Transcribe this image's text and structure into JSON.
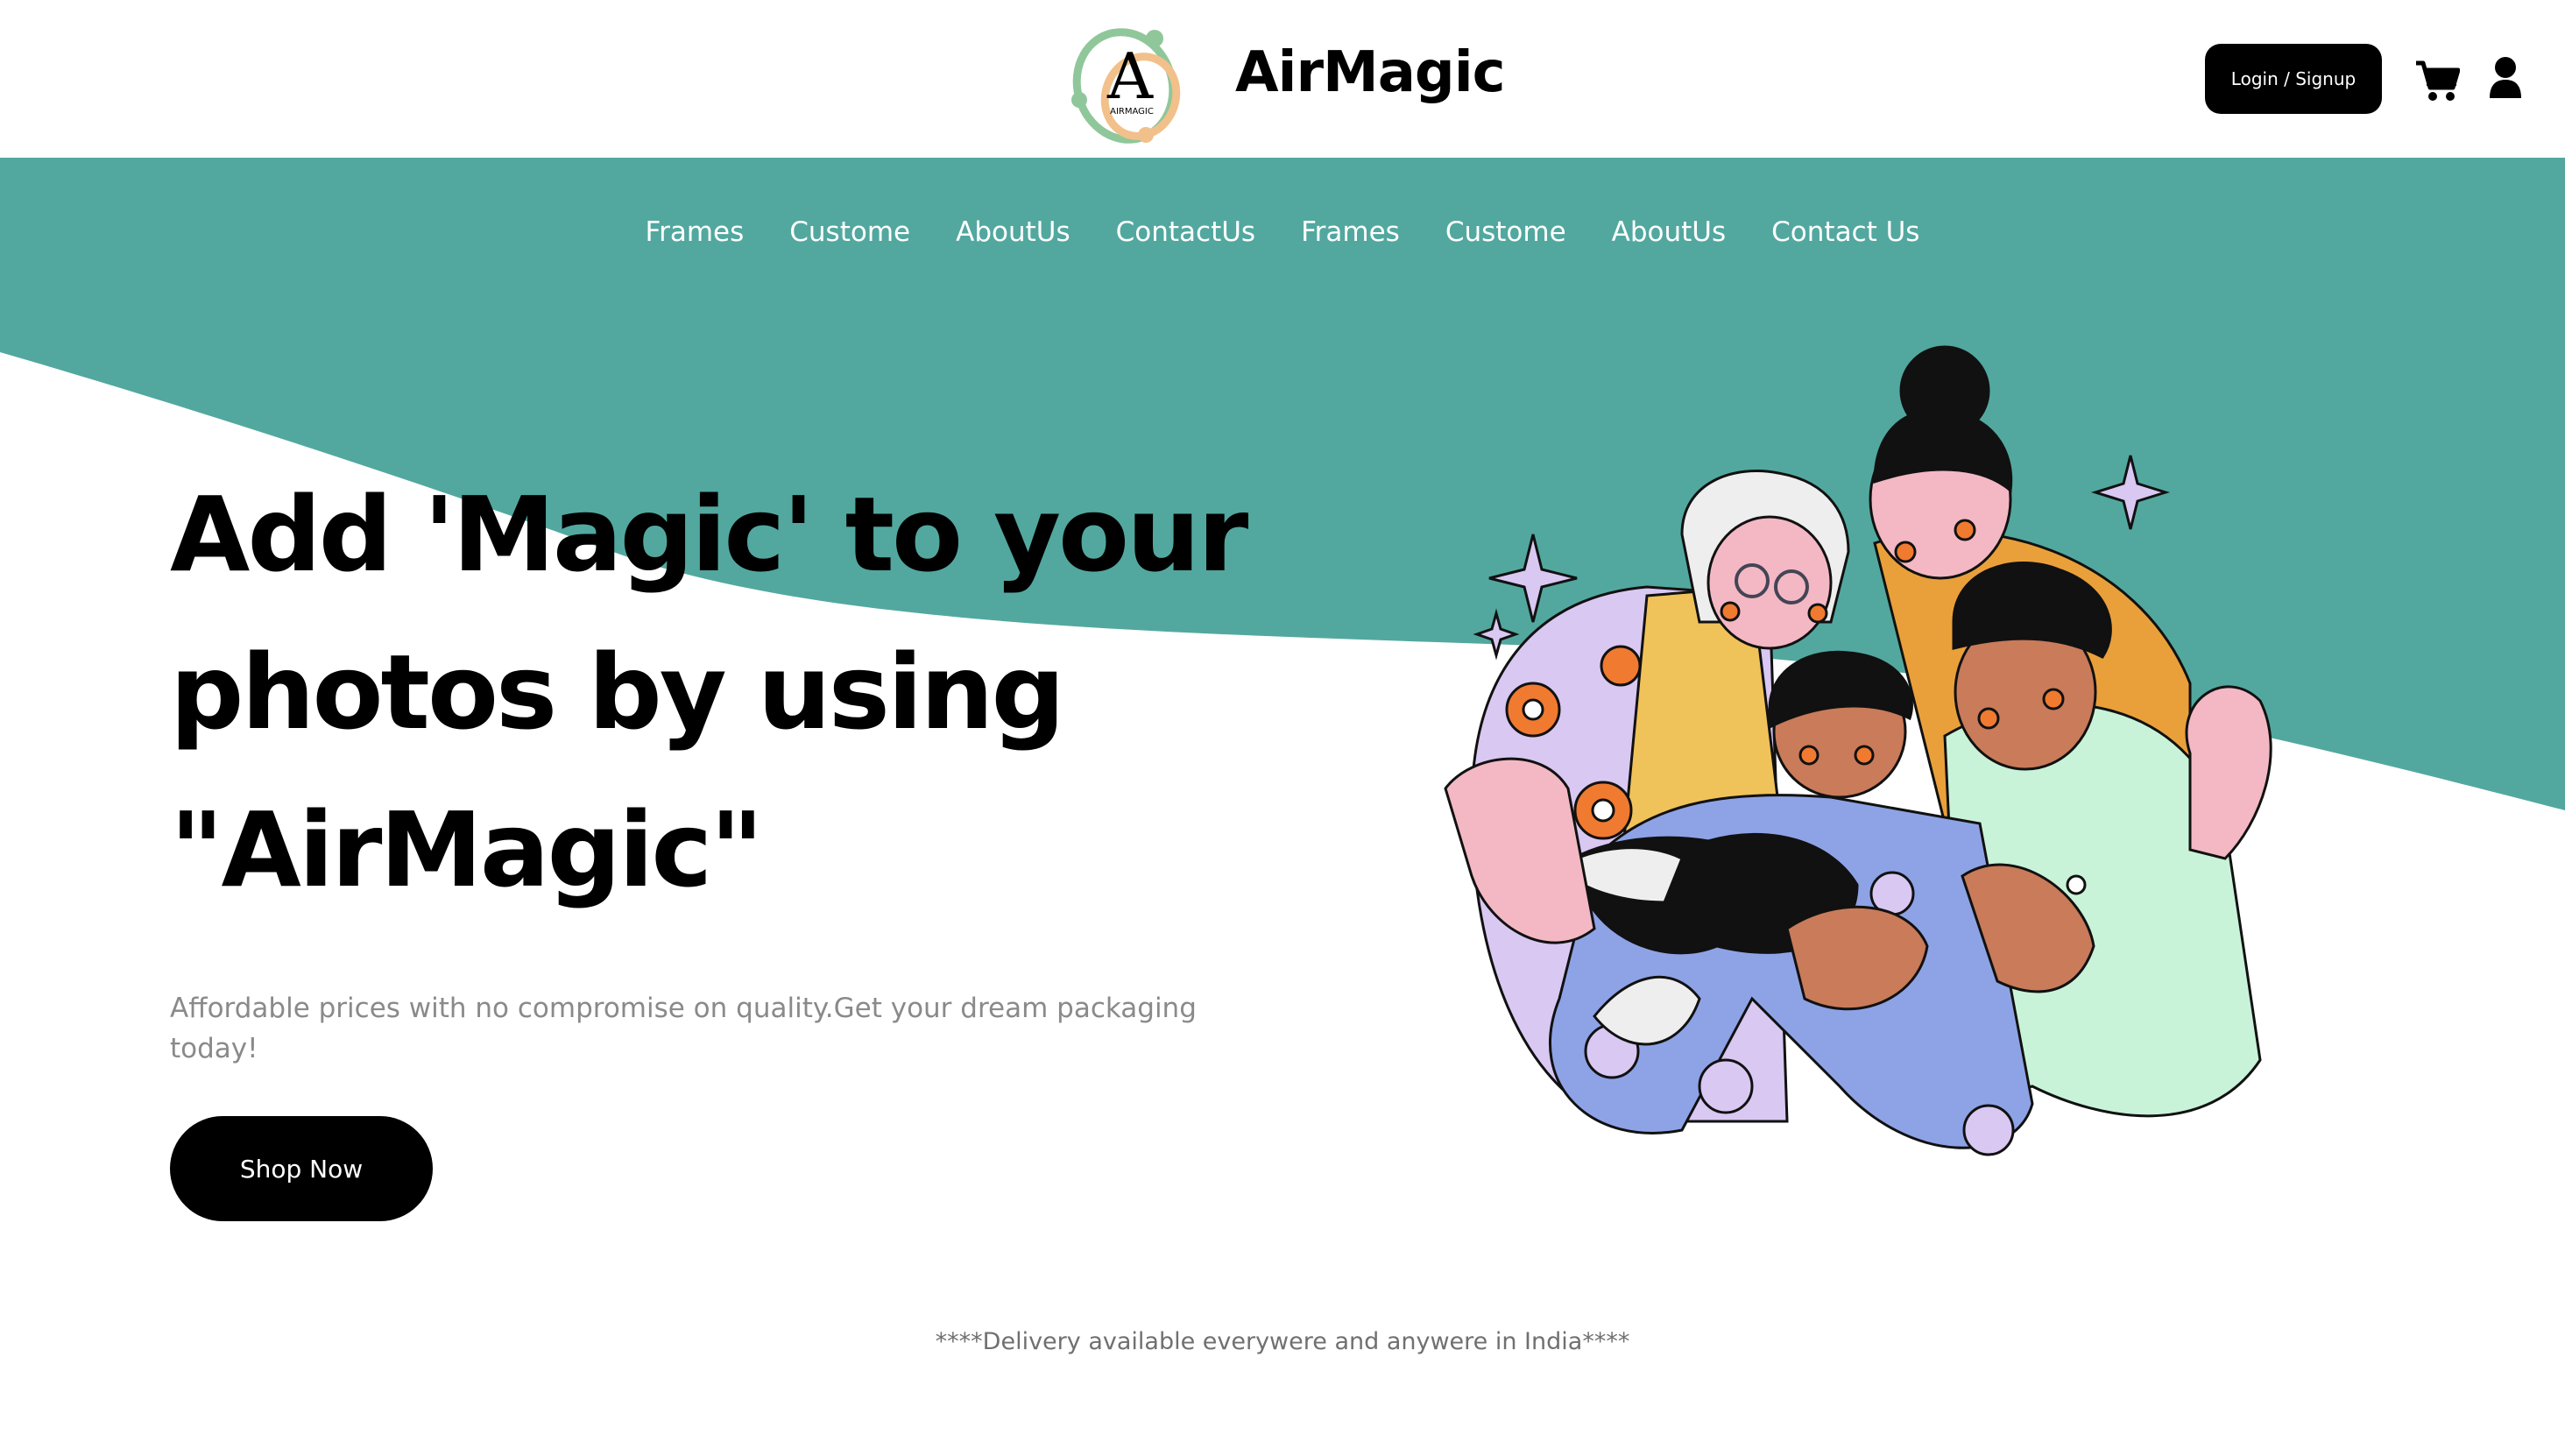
{
  "header": {
    "brand": "AirMagic",
    "logo_letter": "A",
    "logo_small_text": "AIRMAGIC",
    "login_label": "Login / Signup",
    "cart_icon": "cart-icon",
    "user_icon": "user-icon"
  },
  "nav": {
    "items": [
      "Frames",
      "Custome",
      "AboutUs",
      "ContactUs",
      "Frames",
      "Custome",
      "AboutUs",
      "Contact Us"
    ]
  },
  "hero": {
    "title_lines": [
      "Add 'Magic' to your",
      "photos by using",
      "\"AirMagic\""
    ],
    "subtitle": "Affordable prices with no compromise on quality.Get your dream packaging today!",
    "button_label": "Shop Now"
  },
  "footer_note": "****Delivery available everywere and anywere in India****",
  "colors": {
    "teal": "#52a89f",
    "black": "#000000",
    "muted_text": "#8a8a8a"
  }
}
